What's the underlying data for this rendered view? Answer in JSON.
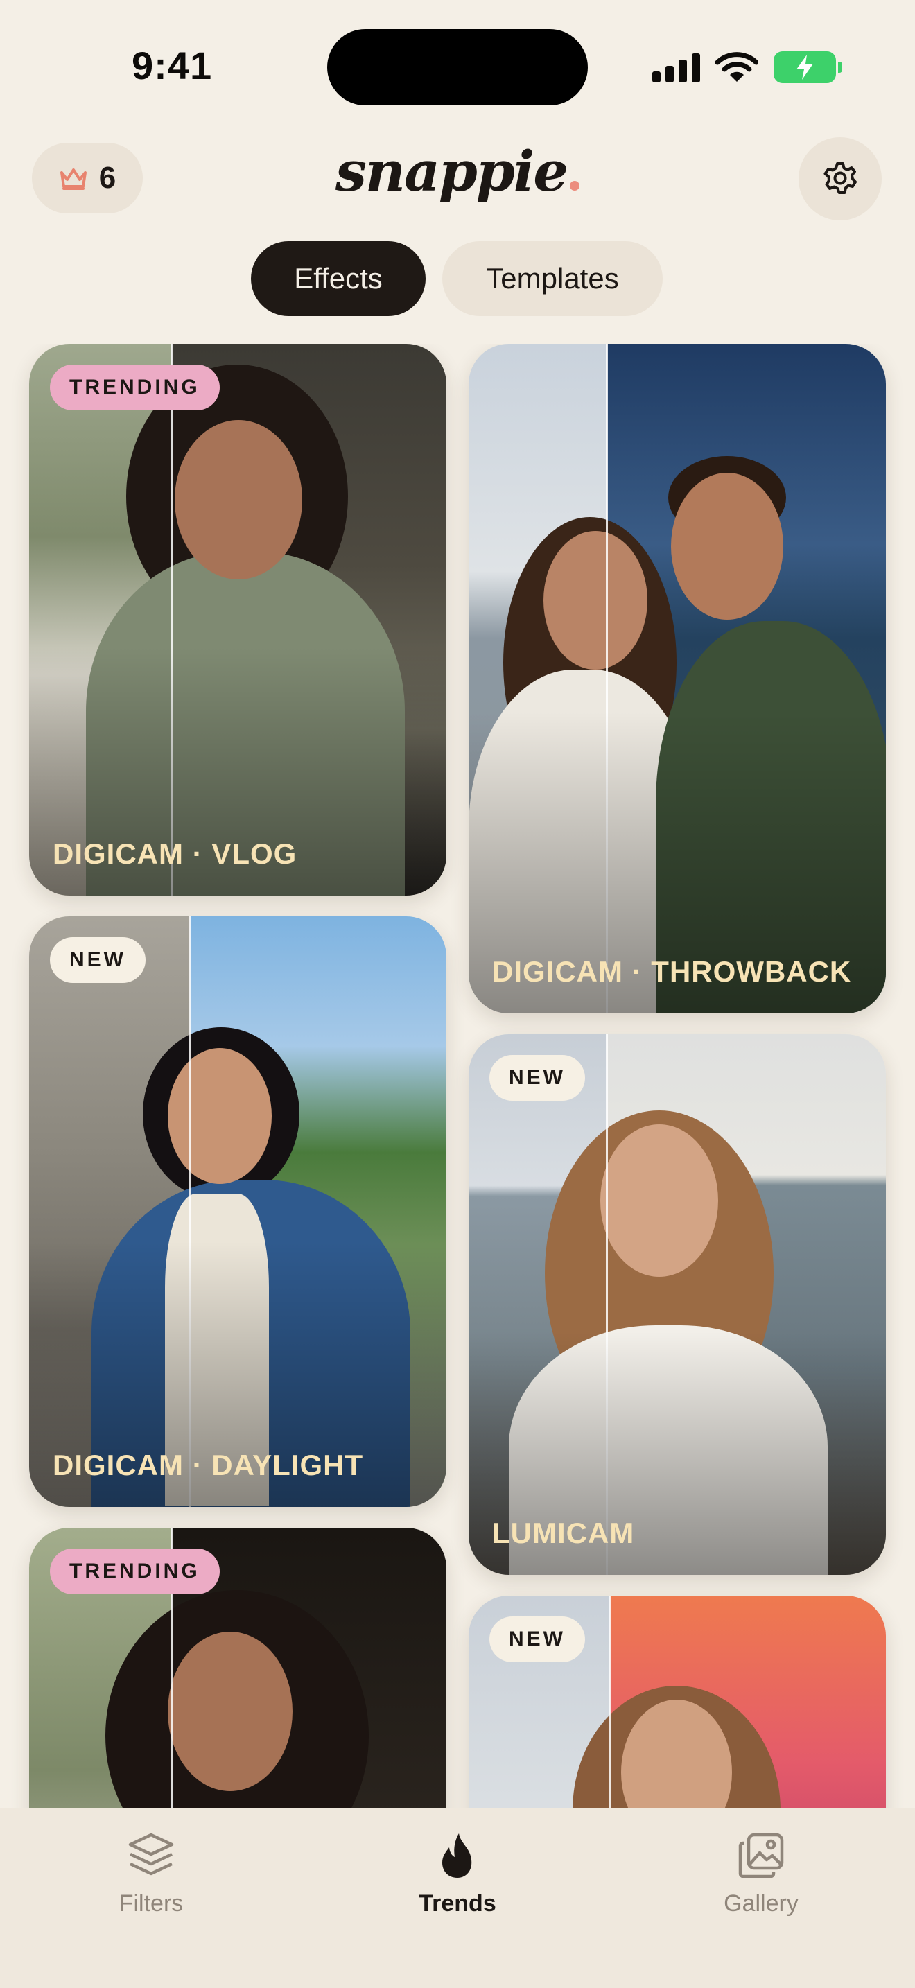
{
  "status_bar": {
    "time": "9:41"
  },
  "header": {
    "credits_count": "6",
    "credits_icon": "crown-icon",
    "logo_text": "snappie",
    "settings_icon": "gear-icon"
  },
  "tabs": [
    {
      "label": "Effects",
      "active": true
    },
    {
      "label": "Templates",
      "active": false
    }
  ],
  "cards": [
    {
      "badge": "TRENDING",
      "label": "DIGICAM · VLOG"
    },
    {
      "badge": "",
      "label": "DIGICAM · THROWBACK"
    },
    {
      "badge": "NEW",
      "label": "DIGICAM · DAYLIGHT"
    },
    {
      "badge": "NEW",
      "label": "LUMICAM"
    },
    {
      "badge": "TRENDING",
      "label": ""
    },
    {
      "badge": "NEW",
      "label": ""
    }
  ],
  "bottom_nav": [
    {
      "label": "Filters",
      "icon": "layers-icon",
      "active": false
    },
    {
      "label": "Trends",
      "icon": "flame-icon",
      "active": true
    },
    {
      "label": "Gallery",
      "icon": "gallery-icon",
      "active": false
    }
  ],
  "colors": {
    "background": "#f4efe6",
    "accent_dark": "#1f1915",
    "trending_badge": "#ecabc5",
    "card_label": "#f7e3b5",
    "battery": "#3dd16a"
  }
}
